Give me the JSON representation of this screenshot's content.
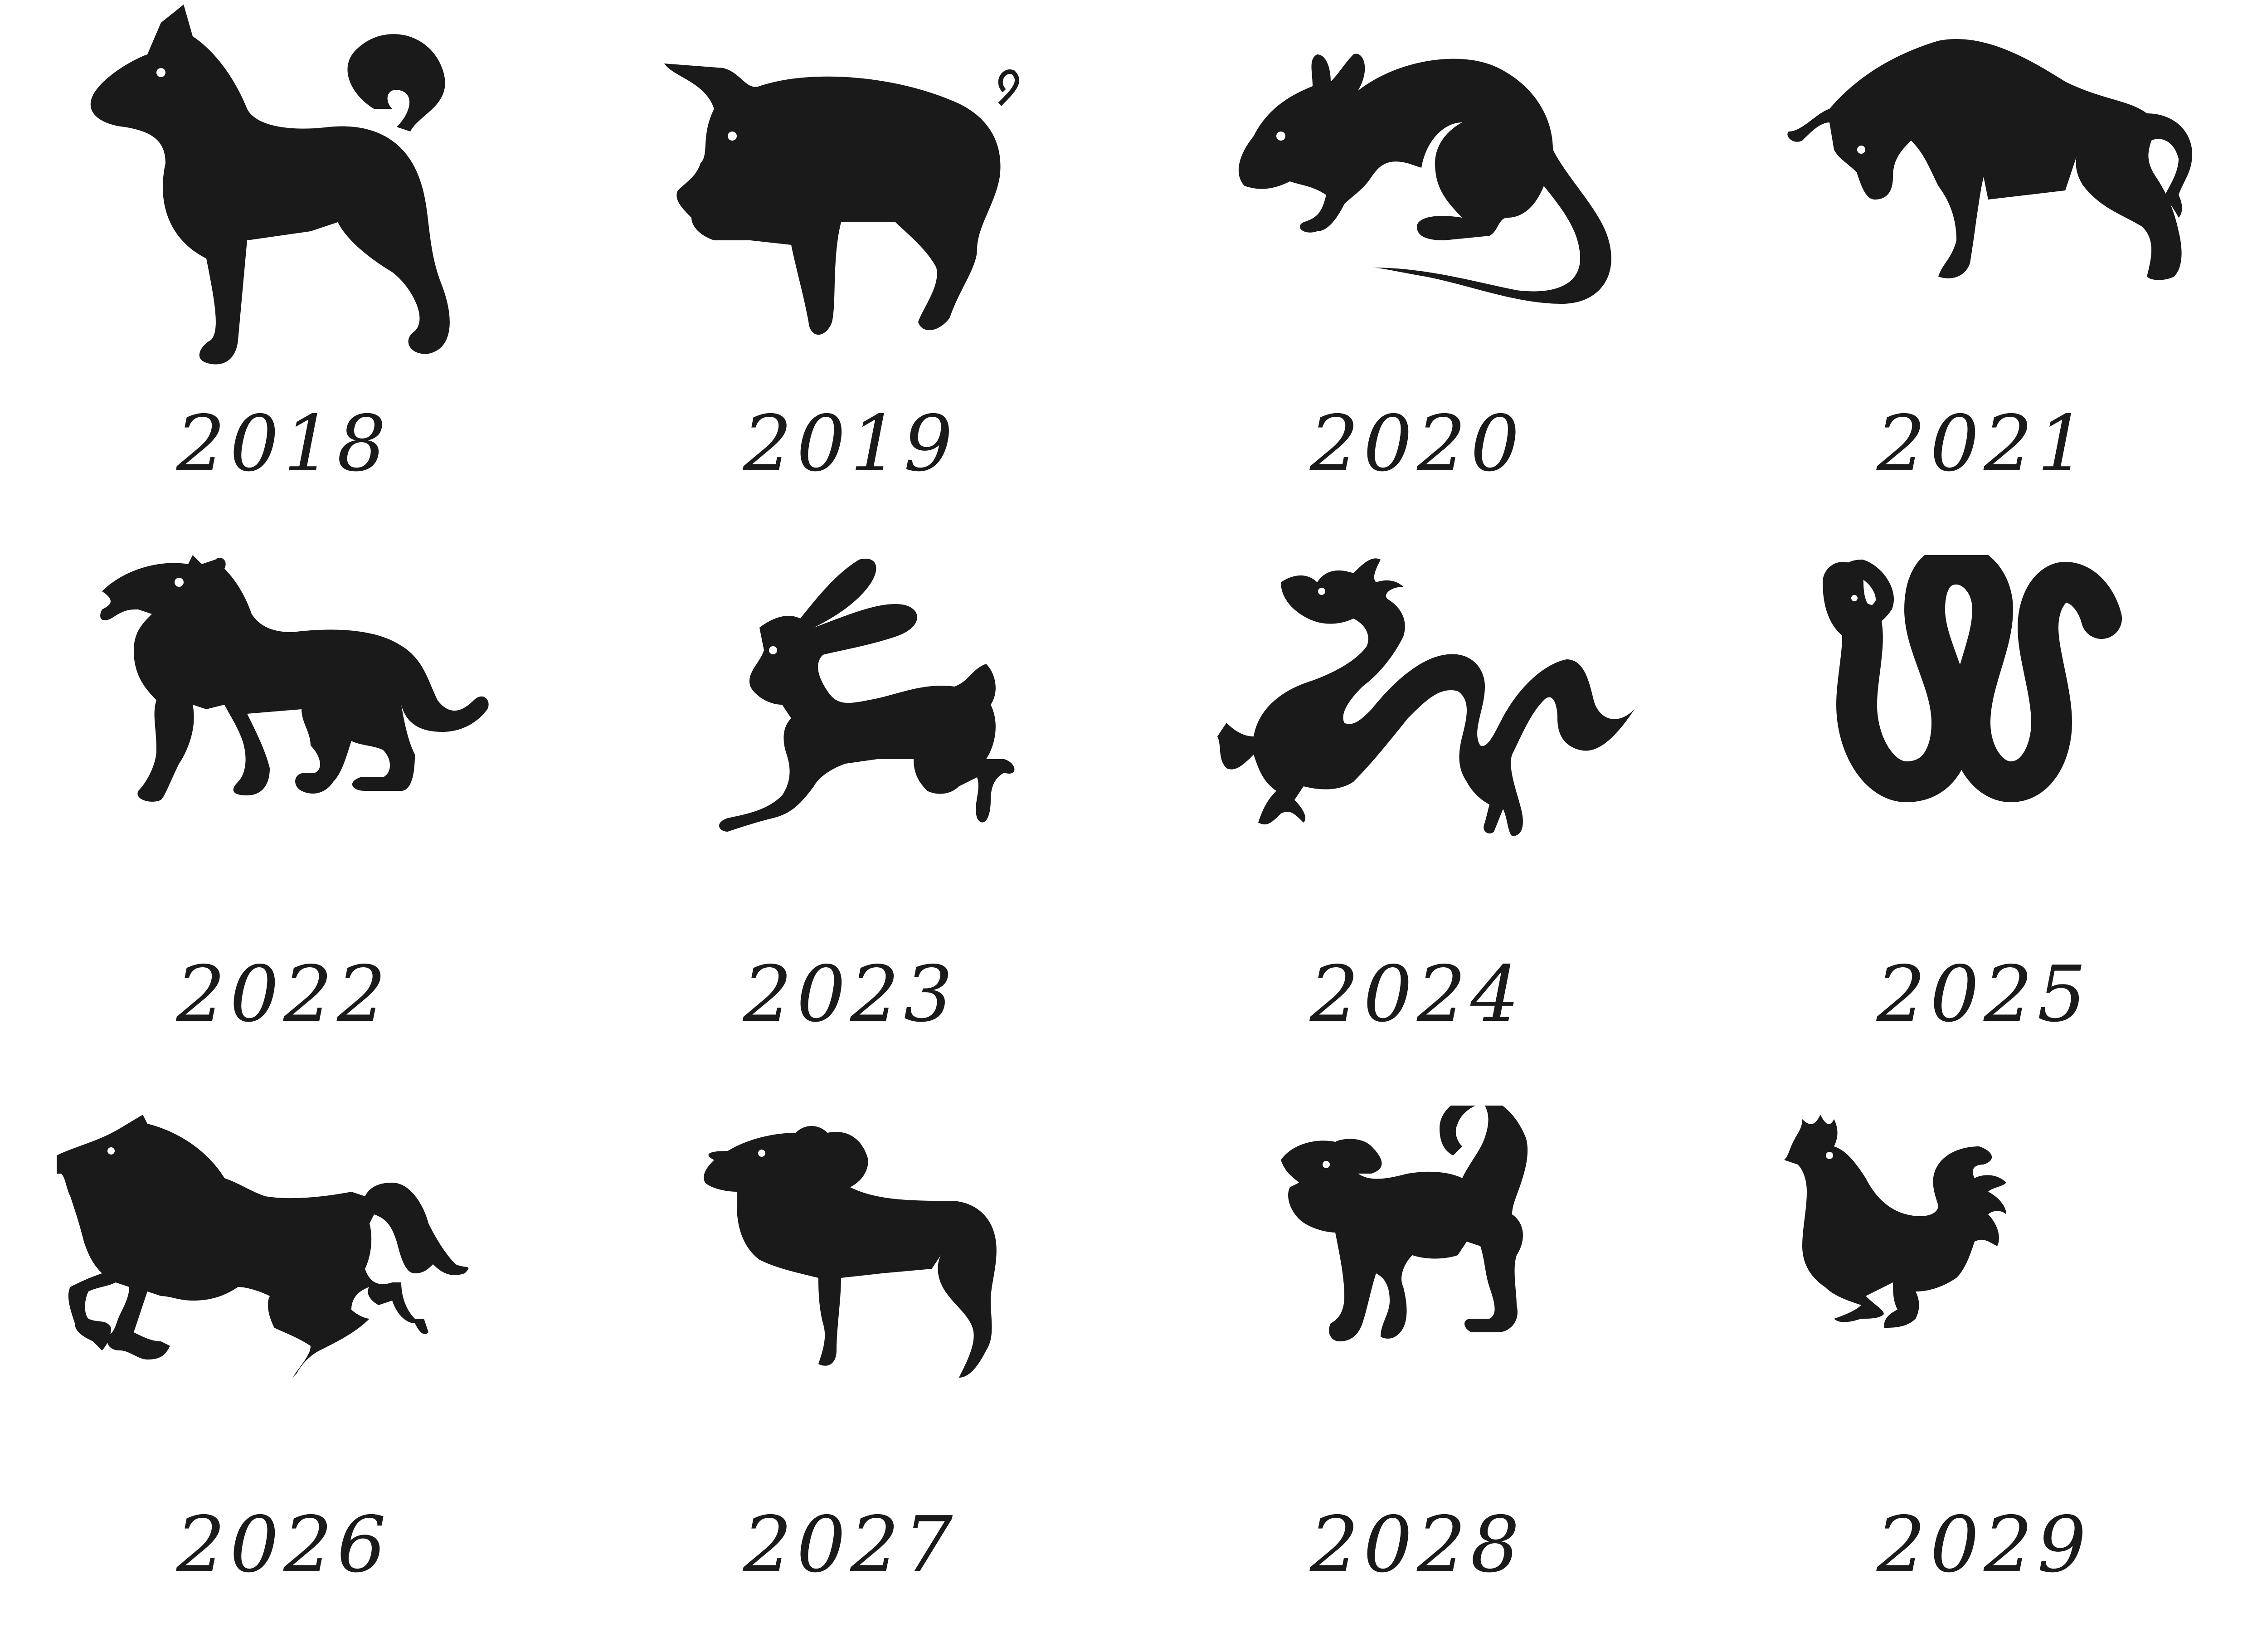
{
  "palette": {
    "ink": "#1a1a1a",
    "background": "#ffffff"
  },
  "zodiac": [
    {
      "year": "2018",
      "icon": "dog-icon"
    },
    {
      "year": "2019",
      "icon": "pig-icon"
    },
    {
      "year": "2020",
      "icon": "rat-icon"
    },
    {
      "year": "2021",
      "icon": "ox-icon"
    },
    {
      "year": "2022",
      "icon": "tiger-icon"
    },
    {
      "year": "2023",
      "icon": "rabbit-icon"
    },
    {
      "year": "2024",
      "icon": "dragon-icon"
    },
    {
      "year": "2025",
      "icon": "snake-icon"
    },
    {
      "year": "2026",
      "icon": "horse-icon"
    },
    {
      "year": "2027",
      "icon": "goat-icon"
    },
    {
      "year": "2028",
      "icon": "monkey-icon"
    },
    {
      "year": "2029",
      "icon": "rooster-icon"
    }
  ]
}
